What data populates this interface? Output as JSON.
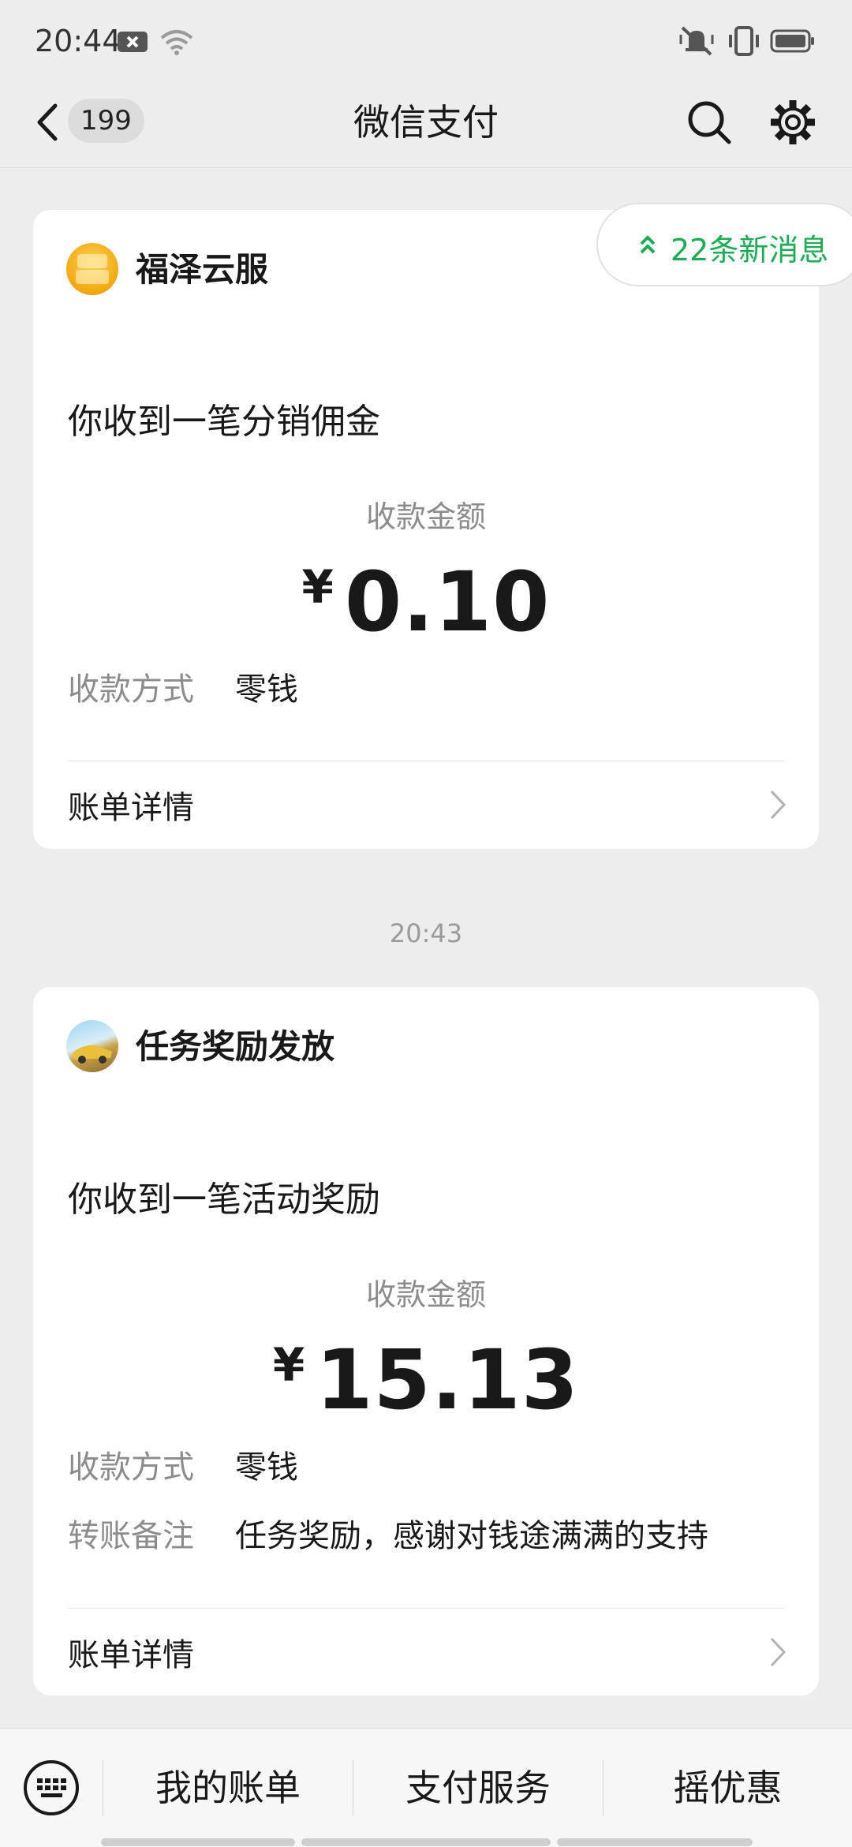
{
  "status_bar": {
    "time": "20:44"
  },
  "nav": {
    "badge": "199",
    "title": "微信支付"
  },
  "new_messages": "22条新消息",
  "cards": [
    {
      "merchant": "福泽云服",
      "message": "你收到一笔分销佣金",
      "amount_label": "收款金额",
      "currency": "¥",
      "amount": "0.10",
      "fields": [
        {
          "label": "收款方式",
          "value": "零钱"
        }
      ],
      "bill_link": "账单详情"
    },
    {
      "merchant": "任务奖励发放",
      "message": "你收到一笔活动奖励",
      "amount_label": "收款金额",
      "currency": "¥",
      "amount": "15.13",
      "fields": [
        {
          "label": "收款方式",
          "value": "零钱"
        },
        {
          "label": "转账备注",
          "value": "任务奖励，感谢对钱途满满的支持"
        }
      ],
      "bill_link": "账单详情"
    }
  ],
  "time_separator": "20:43",
  "bottom_menu": [
    "我的账单",
    "支付服务",
    "摇优惠"
  ],
  "colors": {
    "accent_green": "#1aad54",
    "background": "#ededed",
    "card": "#ffffff"
  }
}
